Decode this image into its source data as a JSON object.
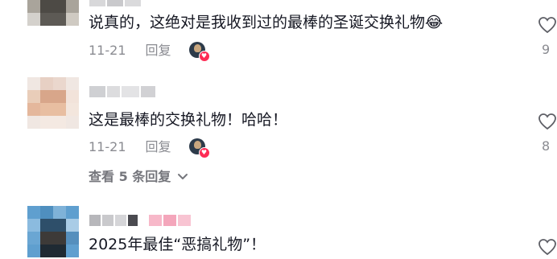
{
  "comments": [
    {
      "text": "说真的，这绝对是我收到过的最棒的圣诞交换礼物😂",
      "date": "11-21",
      "reply_label": "回复",
      "likes": "9"
    },
    {
      "text": "这是最棒的交换礼物！哈哈！",
      "date": "11-21",
      "reply_label": "回复",
      "likes": "8",
      "view_replies": "查看 5 条回复"
    },
    {
      "text": "2025年最佳“恶搞礼物”！"
    }
  ],
  "icons": {
    "like": "heart-outline-icon",
    "liked_by_creator_badge": "heart-badge-icon",
    "expand": "chevron-down-icon"
  },
  "colors": {
    "text": "#161823",
    "meta": "#8a8b91",
    "accent": "#fe2c55"
  }
}
